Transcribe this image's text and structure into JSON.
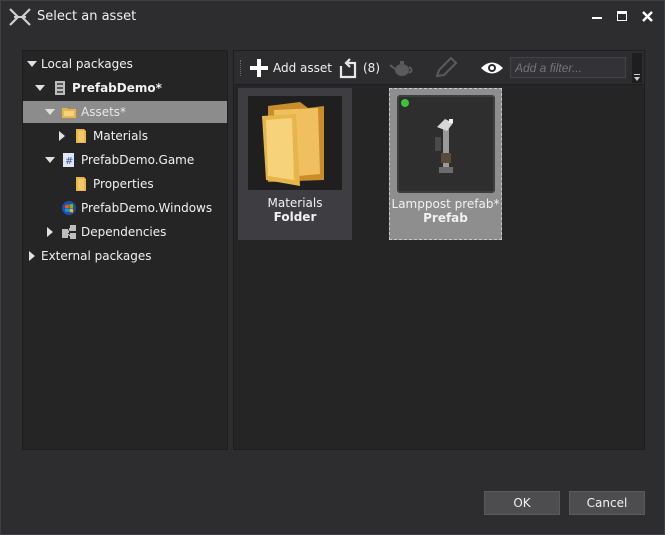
{
  "window": {
    "title": "Select an asset",
    "icons": {
      "logo": "xenko-logo-icon",
      "minimize": "minimize-icon",
      "maximize": "maximize-icon",
      "close": "close-icon"
    }
  },
  "tree": {
    "items": [
      {
        "label": "Local packages",
        "icon": "none",
        "expander": "expanded"
      },
      {
        "label": "PrefabDemo*",
        "icon": "package-icon",
        "expander": "expanded"
      },
      {
        "label": "Assets*",
        "icon": "assets-folder-icon",
        "expander": "expanded",
        "selected": true
      },
      {
        "label": "Materials",
        "icon": "folder-icon",
        "expander": "collapsed"
      },
      {
        "label": "PrefabDemo.Game",
        "icon": "csharp-project-icon",
        "expander": "expanded"
      },
      {
        "label": "Properties",
        "icon": "folder-icon",
        "expander": "none"
      },
      {
        "label": "PrefabDemo.Windows",
        "icon": "windows-project-icon",
        "expander": "none"
      },
      {
        "label": "Dependencies",
        "icon": "dependencies-icon",
        "expander": "collapsed"
      },
      {
        "label": "External packages",
        "icon": "none",
        "expander": "collapsed"
      }
    ]
  },
  "toolbar": {
    "add_asset_label": "Add asset",
    "undo_count": "(8)",
    "filter_placeholder": "Add a filter..."
  },
  "assets": [
    {
      "name": "Materials",
      "type": "Folder",
      "thumbnail": "folder-thumbnail-icon"
    },
    {
      "name": "Lamppost prefab*",
      "type": "Prefab",
      "thumbnail": "lamppost-thumbnail",
      "status_color": "#39c43a",
      "selected": true
    }
  ],
  "buttons": {
    "ok": "OK",
    "cancel": "Cancel"
  },
  "colors": {
    "background": "#2d2d30",
    "panel": "#252526",
    "selection": "#8c8c8c",
    "status_ok": "#39c43a",
    "folder": "#e8b54a"
  }
}
